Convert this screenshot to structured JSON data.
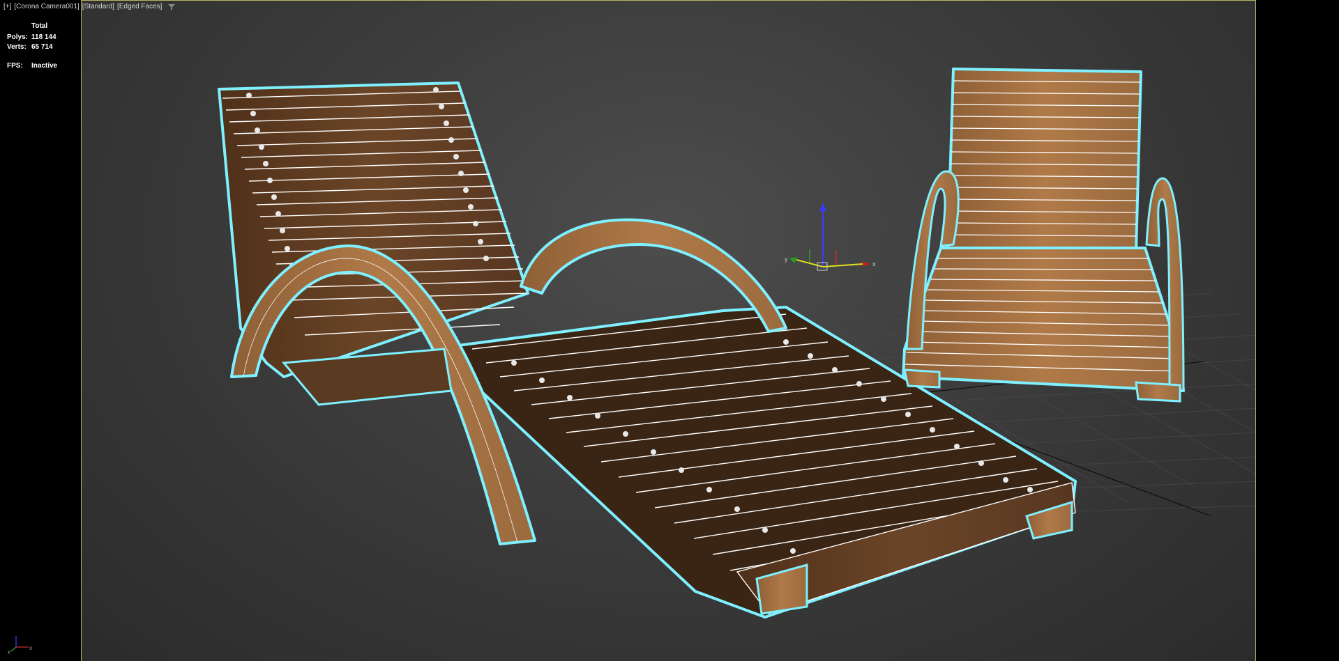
{
  "viewport": {
    "label_plus": "[+]",
    "label_camera": "[Corona Camera001]",
    "label_shading": "[Standard]",
    "label_mode": "[Edged Faces]"
  },
  "stats": {
    "total_label": "Total",
    "polys_label": "Polys:",
    "polys_value": "118 144",
    "verts_label": "Verts:",
    "verts_value": "65 714",
    "fps_label": "FPS:",
    "fps_value": "Inactive"
  },
  "gizmo": {
    "x_label": "x",
    "y_label": "y"
  },
  "colors": {
    "selection": "#7ff0ff",
    "wood": "#6b4527",
    "wood_light": "#b07a48",
    "wire": "#ffffff",
    "viewport_border": "#b8b85a"
  },
  "icons": {
    "filter": "funnel-icon",
    "world_axis": "xyz-axis-icon",
    "transform_gizmo": "move-gizmo-icon"
  }
}
